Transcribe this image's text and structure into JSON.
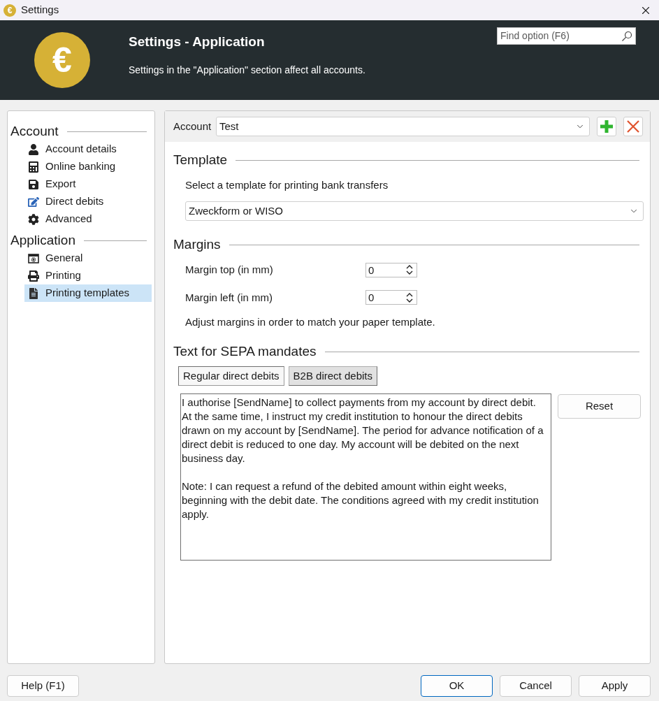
{
  "window": {
    "icon_glyph": "€",
    "title": "Settings"
  },
  "header": {
    "logo_glyph": "€",
    "title": "Settings - Application",
    "subtitle": "Settings in the \"Application\" section affect all accounts.",
    "search": {
      "placeholder": "Find option (F6)"
    }
  },
  "sidebar": {
    "sections": [
      {
        "heading": "Account",
        "items": [
          {
            "label": "Account details",
            "selected": false
          },
          {
            "label": "Online banking",
            "selected": false
          },
          {
            "label": "Export",
            "selected": false
          },
          {
            "label": "Direct debits",
            "selected": false
          },
          {
            "label": "Advanced",
            "selected": false
          }
        ]
      },
      {
        "heading": "Application",
        "items": [
          {
            "label": "General",
            "selected": false
          },
          {
            "label": "Printing",
            "selected": false
          },
          {
            "label": "Printing templates",
            "selected": true
          }
        ]
      }
    ]
  },
  "account_bar": {
    "label": "Account",
    "value": "Test"
  },
  "template": {
    "heading": "Template",
    "prompt": "Select a template for printing bank transfers",
    "value": "Zweckform or WISO"
  },
  "margins": {
    "heading": "Margins",
    "fields": [
      {
        "label": "Margin top (in mm)",
        "value": "0"
      },
      {
        "label": "Margin left (in mm)",
        "value": "0"
      }
    ],
    "hint": "Adjust margins in order to match your paper template."
  },
  "sepa": {
    "heading": "Text for SEPA mandates",
    "tabs": [
      {
        "label": "Regular direct debits",
        "selected": true
      },
      {
        "label": "B2B direct debits",
        "selected": false
      }
    ],
    "text": "I authorise [SendName] to collect payments from my account by direct debit. At the same time, I instruct my credit institution to honour the direct debits drawn on my account by [SendName]. The period for advance notification of a direct debit is reduced to one day. My account will be debited on the next business day.\n\nNote: I can request a refund of the debited amount within eight weeks, beginning with the debit date. The conditions agreed with my credit institution apply.",
    "reset": "Reset"
  },
  "footer": {
    "help": "Help (F1)",
    "buttons": [
      {
        "label": "OK",
        "default": true
      },
      {
        "label": "Cancel",
        "default": false
      },
      {
        "label": "Apply",
        "default": false
      }
    ]
  }
}
